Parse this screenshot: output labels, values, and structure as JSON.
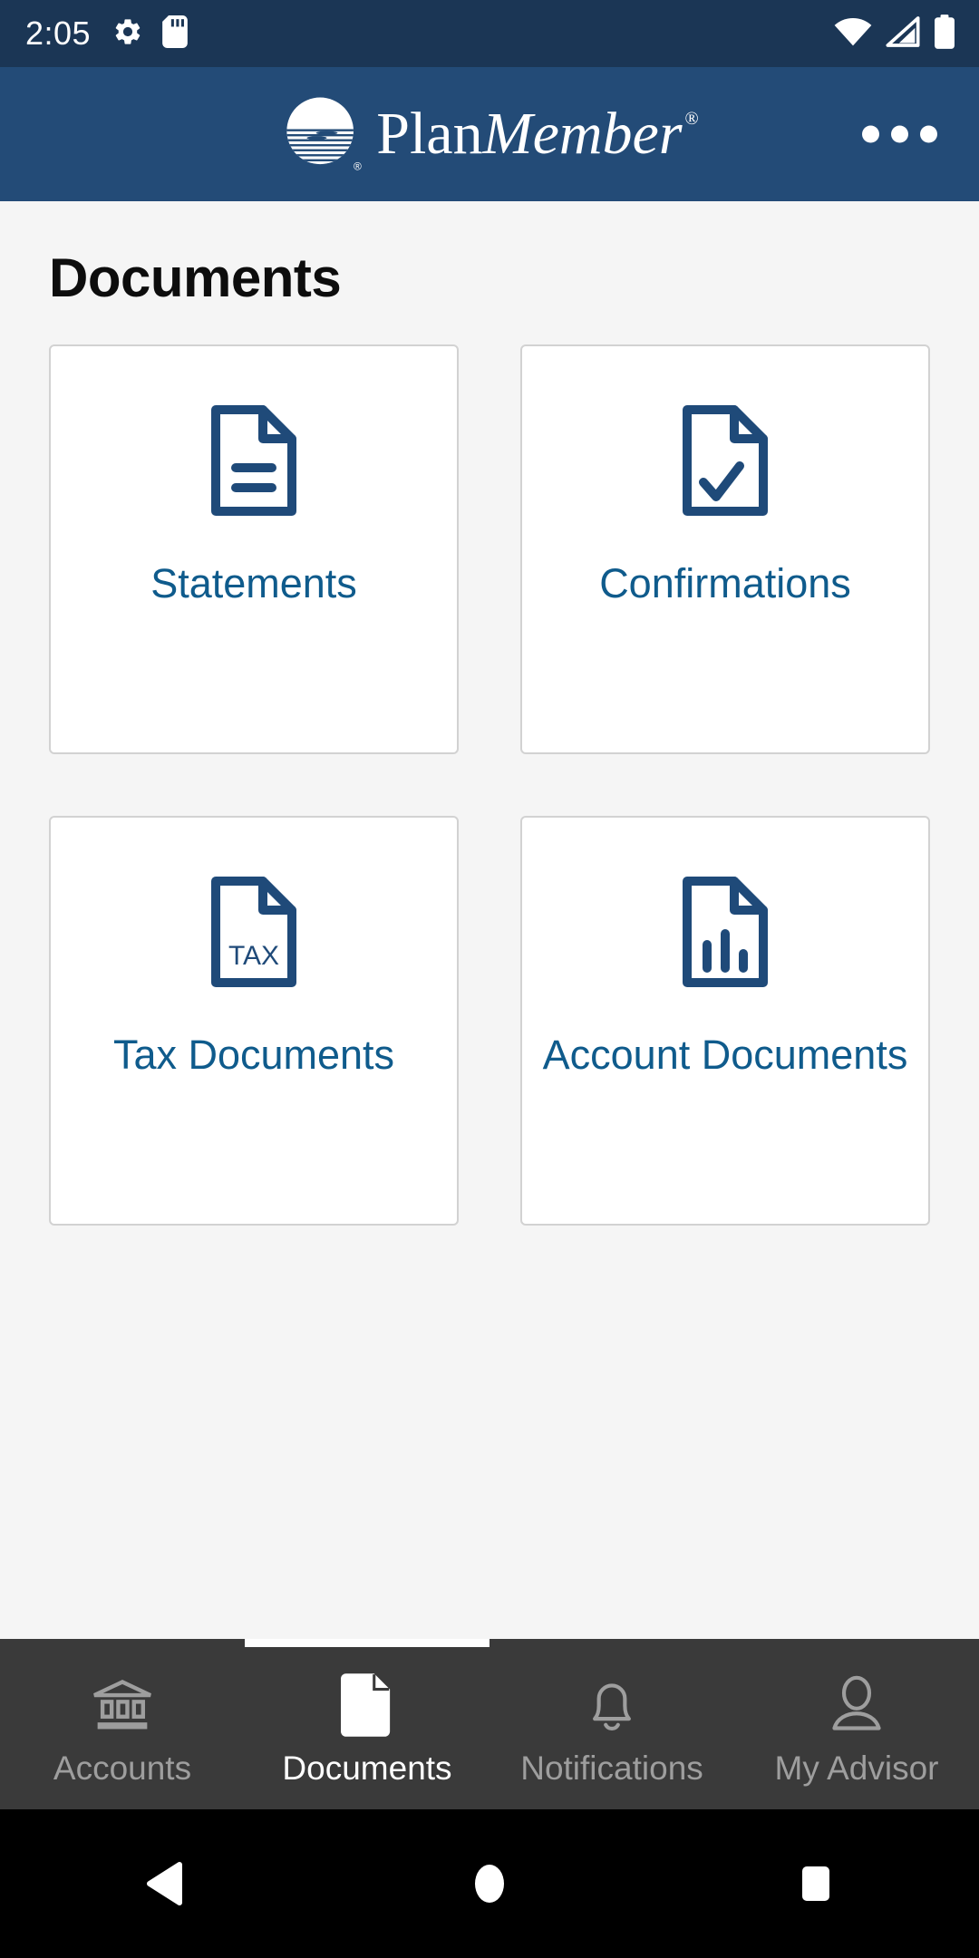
{
  "status_bar": {
    "time": "2:05",
    "left_icons": [
      "gear-icon",
      "sd-card-icon"
    ],
    "right_icons": [
      "wifi-icon",
      "cellular-signal-icon",
      "battery-icon"
    ],
    "background_color": "#1b3655"
  },
  "app_bar": {
    "brand_first": "Plan",
    "brand_second": "Member",
    "registered_mark": "®",
    "logo_name": "planmember-sun-logo",
    "overflow_label": "More options",
    "background_color": "#234b77"
  },
  "page": {
    "title": "Documents",
    "background_color": "#f5f5f5"
  },
  "cards": [
    {
      "label": "Statements",
      "icon": "document-lines-icon",
      "accent": "#1f4a79"
    },
    {
      "label": "Confirmations",
      "icon": "document-check-icon",
      "accent": "#1f4a79"
    },
    {
      "label": "Tax Documents",
      "icon": "document-tax-icon",
      "icon_text": "TAX",
      "accent": "#1f4a79"
    },
    {
      "label": "Account Documents",
      "icon": "document-chart-icon",
      "accent": "#1f4a79"
    }
  ],
  "card_label_color": "#0f5b8c",
  "tabs": [
    {
      "label": "Accounts",
      "icon": "bank-icon",
      "active": false
    },
    {
      "label": "Documents",
      "icon": "document-icon",
      "active": true
    },
    {
      "label": "Notifications",
      "icon": "bell-icon",
      "active": false
    },
    {
      "label": "My Advisor",
      "icon": "person-icon",
      "active": false
    }
  ],
  "tab_bar": {
    "background_color": "#3a3a3a",
    "active_color": "#ffffff",
    "inactive_color": "#9e9e9e"
  },
  "system_nav": {
    "back": "Back",
    "home": "Home",
    "recents": "Recent apps",
    "background_color": "#000000"
  }
}
